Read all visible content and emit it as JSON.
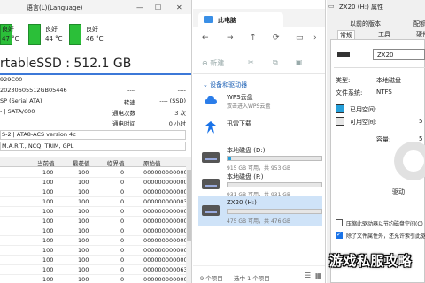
{
  "disk_window": {
    "temps": [
      {
        "label": "",
        "status": "良好",
        "value": "47 °C"
      },
      {
        "label": "语言(L)(Language)",
        "status": "良好",
        "value": "44 °C"
      },
      {
        "label": "",
        "status": "良好",
        "value": "46 °C"
      }
    ],
    "menu_file": "",
    "disk_title": "rtableSSD : 512.1 GB",
    "info_rows": [
      {
        "left": "929C00",
        "mid": "",
        "key": "",
        "val": "----"
      },
      {
        "left": "20230605512GB05446",
        "mid": "",
        "key": "",
        "val": "----"
      },
      {
        "left": "SP (Serial ATA)",
        "mid": "",
        "key": "转速",
        "val": "---- (SSD)"
      },
      {
        "left": "- | SATA/600",
        "mid": "",
        "key": "通电次数",
        "val": "3 次"
      },
      {
        "left": "",
        "mid": "",
        "key": "通电时间",
        "val": "0 小时"
      }
    ],
    "dashes": "----",
    "flags": [
      "S-2 | ATA8-ACS version 4c",
      "M.A.R.T., NCQ, TRIM, GPL"
    ],
    "smart": {
      "headers": [
        "当前值",
        "最差值",
        "临界值",
        "原始值"
      ],
      "rows": [
        [
          "100",
          "100",
          "0",
          "000000000000"
        ],
        [
          "100",
          "100",
          "0",
          "000000000000"
        ],
        [
          "100",
          "100",
          "0",
          "000000000000"
        ],
        [
          "100",
          "100",
          "0",
          "000000000003"
        ],
        [
          "100",
          "100",
          "0",
          "000000000000"
        ],
        [
          "100",
          "100",
          "0",
          "000000000000"
        ],
        [
          "100",
          "100",
          "0",
          "000000000000"
        ],
        [
          "100",
          "100",
          "0",
          "000000000000"
        ],
        [
          "100",
          "100",
          "0",
          "000000000000"
        ],
        [
          "100",
          "100",
          "0",
          "000000000000"
        ],
        [
          "100",
          "100",
          "0",
          "000000000063"
        ],
        [
          "100",
          "100",
          "0",
          "000000000000"
        ]
      ]
    }
  },
  "explorer": {
    "tab_title": "此电脑",
    "nav": [
      "←",
      "→",
      "↑",
      "⟳"
    ],
    "new_label": "新建",
    "section_label": "设备和驱动器",
    "apps": [
      {
        "name": "WPS云盘",
        "desc": "双击进入WPS云盘",
        "icon": "wps-cloud-icon"
      },
      {
        "name": "迅雷下载",
        "desc": "",
        "icon": "thunder-icon"
      }
    ],
    "drives": [
      {
        "name": "本地磁盘 (D:)",
        "desc": "915 GB 可用，共 953 GB",
        "fill": 0.04
      },
      {
        "name": "本地磁盘 (F:)",
        "desc": "931 GB 可用，共 931 GB",
        "fill": 0.01
      },
      {
        "name": "ZX20 (H:)",
        "desc": "475 GB 可用，共 476 GB",
        "fill": 0.01
      }
    ],
    "status_left": "9 个项目",
    "status_mid": "选中 1 个项目"
  },
  "props": {
    "title": "ZX20 (H:) 属性",
    "tabs_row1": [
      "以前的版本",
      "配额"
    ],
    "tabs_row2": [
      "常规",
      "工具",
      "硬件"
    ],
    "name_value": "ZX20",
    "type_label": "类型:",
    "type_value": "本地磁盘",
    "fs_label": "文件系统:",
    "fs_value": "NTFS",
    "used_label": "已用空间:",
    "free_label": "可用空间:",
    "free_value": "5",
    "capacity_label": "容量:",
    "capacity_value": "5",
    "drive_label": "驱动",
    "chk1": "压缩此驱动器以节约磁盘空间(C)",
    "chk2": "除了文件属性外，还允许索引此驱",
    "chk2_on": true,
    "watermark": "游戏私服攻略"
  }
}
